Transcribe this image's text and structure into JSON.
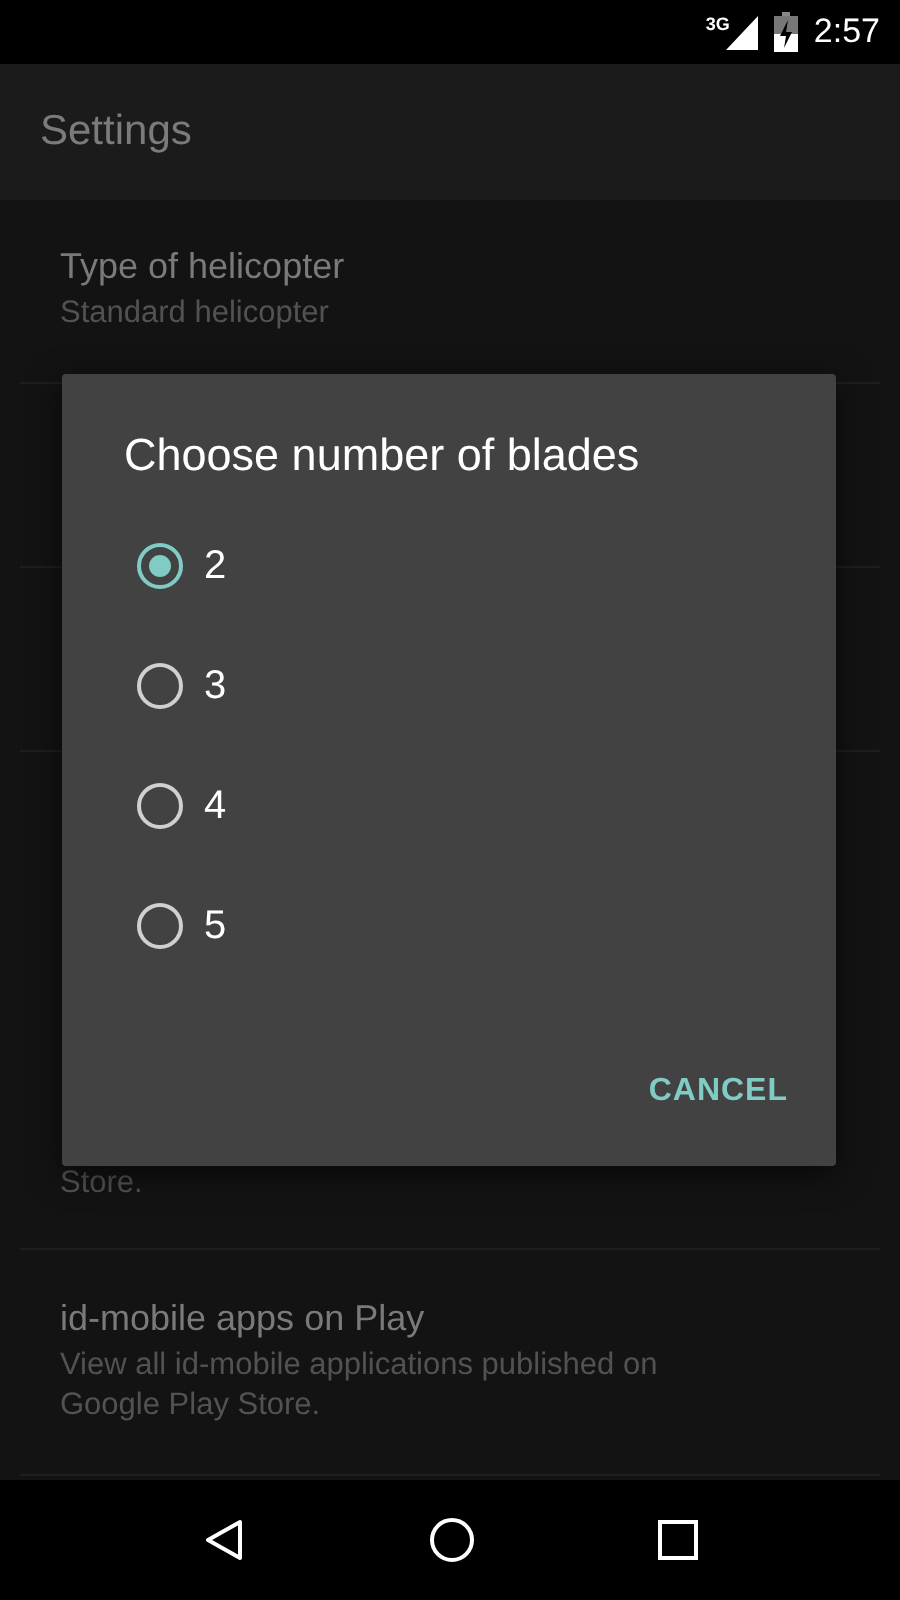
{
  "status_bar": {
    "network": "3G",
    "time": "2:57"
  },
  "app_bar": {
    "title": "Settings"
  },
  "settings": [
    {
      "title": "Type of helicopter",
      "summary": "Standard helicopter"
    },
    {
      "summary": "Store."
    },
    {
      "title": "id-mobile apps on Play",
      "summary": "View all id-mobile applications published on Google Play Store."
    }
  ],
  "dialog": {
    "title": "Choose number of blades",
    "options": [
      {
        "label": "2",
        "selected": true
      },
      {
        "label": "3",
        "selected": false
      },
      {
        "label": "4",
        "selected": false
      },
      {
        "label": "5",
        "selected": false
      }
    ],
    "buttons": [
      "CANCEL"
    ]
  }
}
